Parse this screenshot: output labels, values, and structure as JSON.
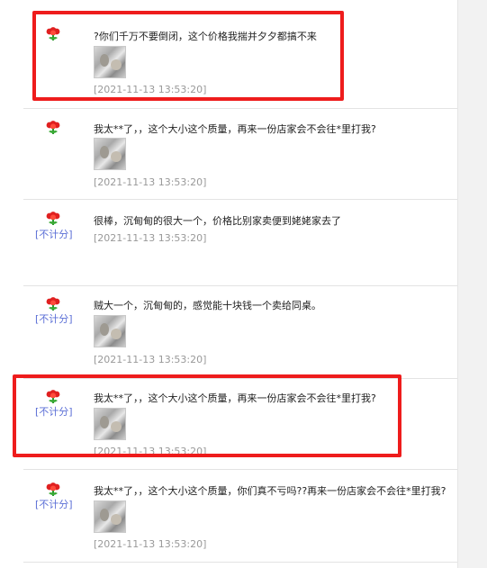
{
  "reviews": [
    {
      "text": "?你们千万不要倒闭，这个价格我揣并夕夕都搞不来",
      "time": "[2021-11-13 13:53:20]",
      "badge": "",
      "has_photo": true
    },
    {
      "text": "我太**了，，这个大小这个质量，再来一份店家会不会往*里打我?",
      "time": "[2021-11-13 13:53:20]",
      "badge": "",
      "has_photo": true
    },
    {
      "text": "很棒，沉甸甸的很大一个，价格比别家卖便到姥姥家去了",
      "time": "[2021-11-13 13:53:20]",
      "badge": "[不计分]",
      "has_photo": false
    },
    {
      "text": "贼大一个，沉甸甸的，感觉能十块钱一个卖给同桌。",
      "time": "[2021-11-13 13:53:20]",
      "badge": "[不计分]",
      "has_photo": true
    },
    {
      "text": "我太**了，，这个大小这个质量，再来一份店家会不会往*里打我?",
      "time": "[2021-11-13 13:53:20]",
      "badge": "[不计分]",
      "has_photo": true
    },
    {
      "text": "我太**了，，这个大小这个质量，你们真不亏吗??再来一份店家会不会往*里打我?",
      "time": "[2021-11-13 13:53:20]",
      "badge": "[不计分]",
      "has_photo": true
    }
  ],
  "icons": {
    "flower": "red-flower-icon"
  },
  "colors": {
    "highlight": "#ee1c1c",
    "badge": "#5b6fd6",
    "time": "#999999"
  }
}
